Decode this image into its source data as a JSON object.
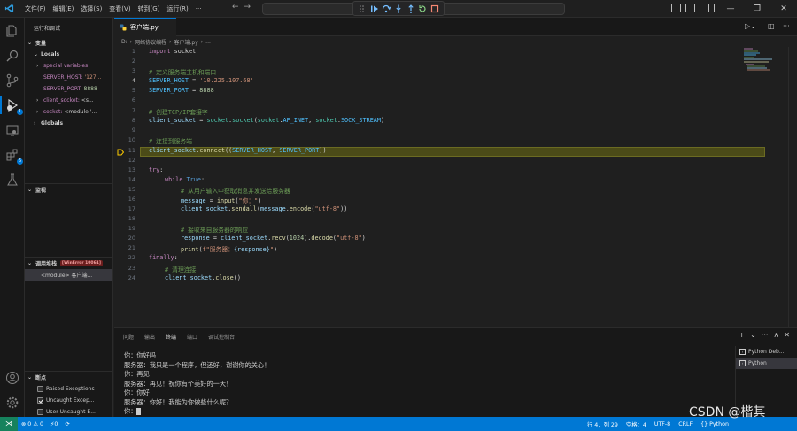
{
  "menu": [
    "文件(F)",
    "编辑(E)",
    "选择(S)",
    "查看(V)",
    "转到(G)",
    "运行(R)",
    "···"
  ],
  "sidebar": {
    "title": "运行和调试",
    "more": "···",
    "variables_label": "变量",
    "locals_label": "Locals",
    "special_variables": "special variables",
    "server_host_name": "SERVER_HOST:",
    "server_host_val": "'127...",
    "server_port_name": "SERVER_PORT:",
    "server_port_val": "8888",
    "client_socket_name": "client_socket:",
    "client_socket_val": "<s...",
    "socket_name": "socket:",
    "socket_val": "<module '...",
    "globals_label": "Globals",
    "watch_label": "监视",
    "callstack_label": "调用堆栈",
    "callstack_badge": "[WinError 10061]",
    "callstack_frame": "<module>   客户端...",
    "breakpoints_label": "断点",
    "bp1": "Raised Exceptions",
    "bp2": "Uncaught Excep...",
    "bp3": "User Uncaught E..."
  },
  "tab": {
    "label": "客户端.py"
  },
  "breadcrumb": [
    "D:",
    "网络协议编程",
    "客户端.py",
    "..."
  ],
  "code": {
    "l1a": "import",
    "l1b": " socket",
    "l3": "# 定义服务端主机和端口",
    "l4a": "SERVER_HOST",
    "l4b": " = ",
    "l4c": "'10.225.107.68'",
    "l5a": "SERVER_PORT",
    "l5b": " = ",
    "l5c": "8888",
    "l7": "# 创建TCP/IP套接字",
    "l8a": "client_socket",
    "l8b": " = ",
    "l8c": "socket",
    "l8d": ".",
    "l8e": "socket",
    "l8f": "(",
    "l8g": "socket",
    "l8h": ".",
    "l8i": "AF_INET",
    "l8j": ", ",
    "l8k": "socket",
    "l8l": ".",
    "l8m": "SOCK_STREAM",
    "l8n": ")",
    "l10": "# 连接到服务端",
    "l11a": "client_socket",
    "l11b": ".",
    "l11c": "connect",
    "l11d": "((",
    "l11e": "SERVER_HOST",
    "l11f": ", ",
    "l11g": "SERVER_PORT",
    "l11h": "))",
    "l13a": "try",
    "l13b": ":",
    "l14a": "while",
    "l14b": " True",
    "l14c": ":",
    "l15": "# 从用户输入中获取消息并发送给服务器",
    "l16a": "message",
    "l16b": " = ",
    "l16c": "input",
    "l16d": "(",
    "l16e": "\"你：\"",
    "l16f": ")",
    "l17a": "client_socket",
    "l17b": ".",
    "l17c": "sendall",
    "l17d": "(",
    "l17e": "message",
    "l17f": ".",
    "l17g": "encode",
    "l17h": "(",
    "l17i": "\"utf-8\"",
    "l17j": "))",
    "l19": "# 接收来自服务器的响应",
    "l20a": "response",
    "l20b": " = ",
    "l20c": "client_socket",
    "l20d": ".",
    "l20e": "recv",
    "l20f": "(",
    "l20g": "1024",
    "l20h": ").",
    "l20i": "decode",
    "l20j": "(",
    "l20k": "\"utf-8\"",
    "l20l": ")",
    "l21a": "print",
    "l21b": "(",
    "l21c": "f\"服务器：",
    "l21d": "{response}",
    "l21e": "\"",
    "l21f": ")",
    "l22a": "finally",
    "l22b": ":",
    "l23": "# 清理连接",
    "l24a": "client_socket",
    "l24b": ".",
    "l24c": "close",
    "l24d": "()"
  },
  "line_numbers": [
    "1",
    "2",
    "3",
    "4",
    "5",
    "6",
    "7",
    "8",
    "9",
    "10",
    "11",
    "12",
    "13",
    "14",
    "15",
    "16",
    "17",
    "18",
    "19",
    "20",
    "21",
    "22",
    "23",
    "24"
  ],
  "panel": {
    "tabs": [
      "问题",
      "输出",
      "终端",
      "端口",
      "调试控制台"
    ],
    "actions": [
      "+",
      "⌄",
      "···",
      "∧",
      "✕"
    ],
    "terminal_lines": [
      "你：你好吗",
      "服务器：我只是一个程序，但还好，谢谢你的关心！",
      "你：再见",
      "服务器：再见！祝你有个美好的一天！",
      "你：你好",
      "服务器：你好！我能为你做些什么呢？",
      "你："
    ],
    "terminals": [
      "Python Deb...",
      "Python"
    ]
  },
  "status": {
    "errors": "⊗ 0",
    "warnings": "⚠ 0",
    "ports": "⚡0",
    "cursor_pos": "行 4，列 29",
    "spaces": "空格：4",
    "encoding": "UTF-8",
    "eol": "CRLF",
    "language": "{} Python"
  },
  "watermark": "CSDN @楷其"
}
